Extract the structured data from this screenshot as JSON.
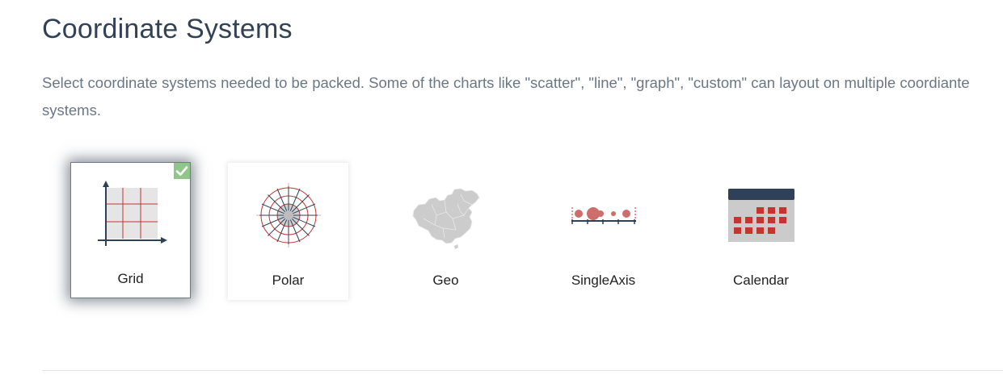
{
  "section": {
    "title": "Coordinate Systems",
    "description": "Select coordinate systems needed to be packed. Some of the charts like \"scatter\", \"line\", \"graph\", \"custom\" can layout on multiple coordiante systems."
  },
  "options": [
    {
      "label": "Grid",
      "icon": "grid-chart-icon",
      "selected": true
    },
    {
      "label": "Polar",
      "icon": "polar-chart-icon",
      "selected": false
    },
    {
      "label": "Geo",
      "icon": "china-map-icon",
      "selected": false
    },
    {
      "label": "SingleAxis",
      "icon": "single-axis-icon",
      "selected": false
    },
    {
      "label": "Calendar",
      "icon": "calendar-icon",
      "selected": false
    }
  ],
  "colors": {
    "title": "#334155",
    "description": "#6b7785",
    "accent_red": "#c23531",
    "axis_dark": "#2f4159",
    "grid_fill": "#e5e5e5",
    "check_green": "#90c68a"
  }
}
